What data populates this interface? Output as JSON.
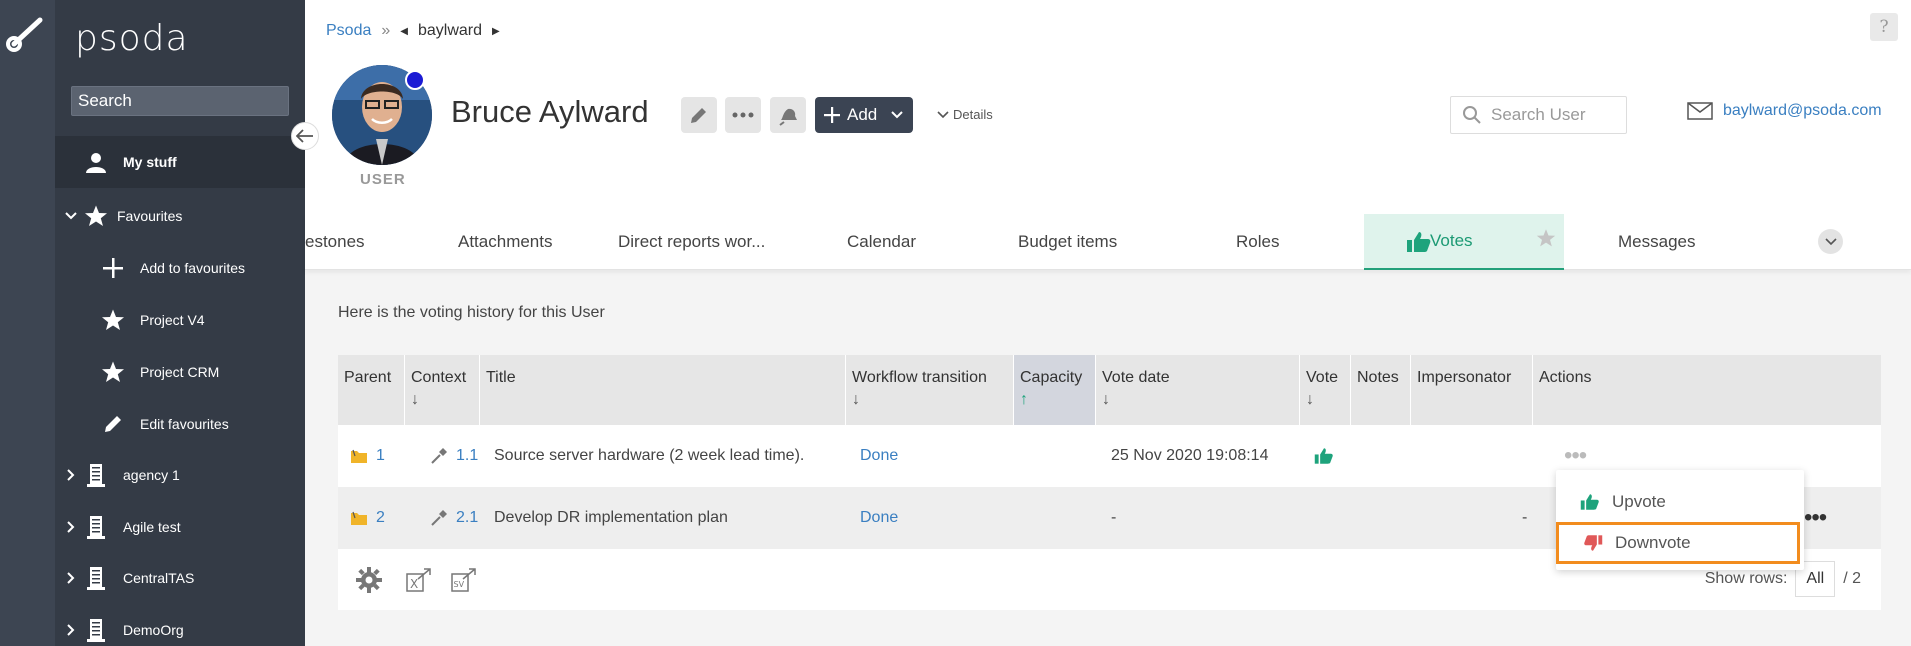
{
  "app": {
    "logo": "psoda",
    "search_placeholder": "Search"
  },
  "sidebar": {
    "my_stuff": "My stuff",
    "favourites": "Favourites",
    "favourite_items": [
      {
        "label": "Add to favourites",
        "icon": "plus-icon"
      },
      {
        "label": "Project V4",
        "icon": "star-icon"
      },
      {
        "label": "Project CRM",
        "icon": "star-icon"
      },
      {
        "label": "Edit favourites",
        "icon": "pencil-icon"
      }
    ],
    "orgs": [
      "agency 1",
      "Agile test",
      "CentralTAS",
      "DemoOrg"
    ]
  },
  "breadcrumb": {
    "root": "Psoda",
    "separator": "»",
    "current": "baylward"
  },
  "user": {
    "name": "Bruce Aylward",
    "role": "USER",
    "email": "baylward@psoda.com"
  },
  "header": {
    "add_label": "Add",
    "details_label": "Details",
    "search_user_placeholder": "Search User",
    "help": "?"
  },
  "tabs": [
    "estones",
    "Attachments",
    "Direct reports wor...",
    "Calendar",
    "Budget items",
    "Roles",
    "Votes",
    "Messages"
  ],
  "content": {
    "intro": "Here is the voting history for this User"
  },
  "table": {
    "headers": {
      "parent": "Parent",
      "context": "Context",
      "title": "Title",
      "workflow": "Workflow transition",
      "capacity": "Capacity",
      "vote_date": "Vote date",
      "vote": "Vote",
      "notes": "Notes",
      "impersonator": "Impersonator",
      "actions": "Actions"
    },
    "sort_arrow_down": "↓",
    "sort_arrow_up": "↑",
    "rows": [
      {
        "parent": "1",
        "context": "1.1",
        "title": "Source server hardware (2 week lead time).",
        "workflow": "Done",
        "vote_date": "25 Nov 2020 19:08:14",
        "vote": ""
      },
      {
        "parent": "2",
        "context": "2.1",
        "title": "Develop DR implementation plan",
        "workflow": "Done",
        "vote_date": "-",
        "vote": "-"
      }
    ],
    "actions_dots": "•••",
    "show_rows_label": "Show rows:",
    "rows_value": "All",
    "total": "/ 2"
  },
  "vote_menu": {
    "upvote": "Upvote",
    "downvote": "Downvote"
  },
  "colors": {
    "sidebar_bg": "#343b46",
    "accent_green": "#1ea37c",
    "link_blue": "#3a7fc1",
    "downvote_red": "#e05858",
    "highlight_orange": "#f28c1e"
  }
}
